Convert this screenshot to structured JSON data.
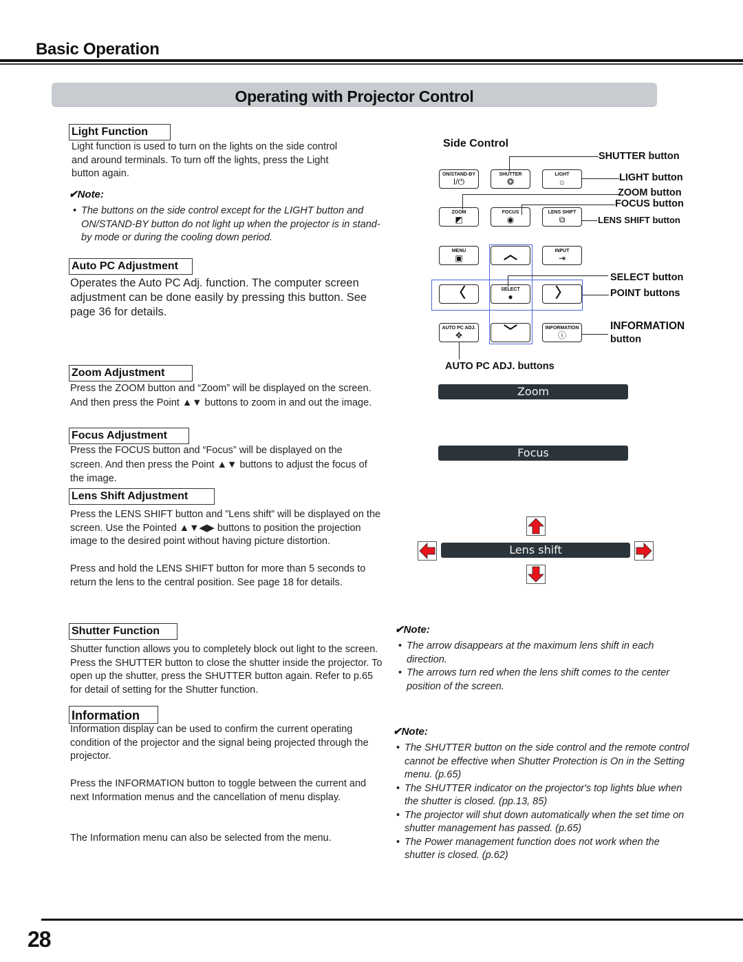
{
  "header": {
    "section_title": "Basic Operation",
    "banner_title": "Operating with Projector Control"
  },
  "light_function": {
    "heading": "Light Function",
    "body": "Light function is used to turn on the lights on the side control and around terminals. To turn off the lights, press the Light button again.",
    "note_title": "✔Note:",
    "notes": [
      "The buttons on the side control except for the LIGHT button and ON/STAND-BY button do not light up when the projector is in stand-by mode or during the cooling down period."
    ]
  },
  "auto_pc": {
    "heading": "Auto PC Adjustment",
    "body": "Operates the Auto PC Adj. function. The computer screen adjustment can be done easily by pressing this button. See page 36 for details."
  },
  "zoom_adj": {
    "heading": "Zoom Adjustment",
    "body": "Press the ZOOM button and “Zoom” will be displayed on the screen. And then press the Point ▲▼ buttons to zoom in and out the image."
  },
  "focus_adj": {
    "heading": "Focus Adjustment",
    "body": "Press the FOCUS button and “Focus” will be displayed on the screen. And then press the Point ▲▼ buttons to adjust the focus of the image."
  },
  "lens_shift_adj": {
    "heading": "Lens Shift Adjustment",
    "body1": "Press the LENS SHIFT button and ”Lens shift” will be displayed on the screen. Use the Pointed ▲▼◀▶ buttons to position the projection image to the desired point without having picture distortion.",
    "body2": "Press and hold the LENS SHIFT button for more than 5 seconds to return the lens to the central position. See page 18 for details."
  },
  "shutter": {
    "heading": "Shutter Function",
    "body": "Shutter function allows you to completely block out light to the screen. Press the SHUTTER button to close the shutter inside the projector. To open up the shutter, press the SHUTTER button again. Refer to p.65 for detail of setting for the Shutter function."
  },
  "information": {
    "heading": "Information",
    "body1": "Information display can be used to confirm the current operating condition of the projector and the signal being projected through the projector.",
    "body2": "Press the INFORMATION button to toggle between the current and next Information menus and the cancellation of menu display.",
    "body3": "The Information menu can also be selected from the menu."
  },
  "side_control": {
    "title": "Side Control",
    "buttons": {
      "on_standby": {
        "label": "ON/STAND-BY",
        "icon": "I/⏻"
      },
      "shutter": {
        "label": "SHUTTER",
        "icon": "❂"
      },
      "light": {
        "label": "LIGHT",
        "icon": "☼"
      },
      "zoom": {
        "label": "ZOOM",
        "icon": "◩"
      },
      "focus": {
        "label": "FOCUS",
        "icon": "◉"
      },
      "lens_shift": {
        "label": "LENS SHIFT",
        "icon": "⧉"
      },
      "menu": {
        "label": "MENU",
        "icon": "▣"
      },
      "up": {
        "label": "",
        "icon": "︿"
      },
      "input": {
        "label": "INPUT",
        "icon": "⇥"
      },
      "left": {
        "label": "",
        "icon": "〈"
      },
      "select": {
        "label": "SELECT",
        "icon": "●"
      },
      "right": {
        "label": "",
        "icon": "〉"
      },
      "auto_pc": {
        "label": "AUTO PC ADJ.",
        "icon": "✥"
      },
      "down": {
        "label": "",
        "icon": "﹀"
      },
      "information": {
        "label": "INFORMATION",
        "icon": "ⓘ"
      }
    },
    "callouts": {
      "shutter": "SHUTTER button",
      "light": "LIGHT button",
      "zoom": "ZOOM button",
      "focus": "FOCUS button",
      "lens_shift": "LENS SHIFT button",
      "select": "SELECT button",
      "point": "POINT buttons",
      "information_1": "INFORMATION",
      "information_2": "button",
      "auto_pc": "AUTO PC ADJ. buttons"
    }
  },
  "osd": {
    "zoom": "Zoom",
    "focus": "Focus",
    "lens_shift": "Lens shift",
    "arrow_color": "#e8141c"
  },
  "lens_note": {
    "title": "✔Note:",
    "notes": [
      "The arrow disappears at the maximum lens shift in each direction.",
      "The arrows turn red when the lens shift comes to the center position of the screen."
    ]
  },
  "shutter_note": {
    "title": "✔Note:",
    "notes": [
      "The SHUTTER button on the side control and the remote control cannot be effective when Shutter Protection is On in the Setting menu. (p.65)",
      "The SHUTTER indicator on the projector's top lights blue when the shutter is closed. (pp.13, 85)",
      "The projector will shut down automatically when the set time on shutter management has passed. (p.65)",
      "The Power management function does not work when the shutter is closed. (p.62)"
    ]
  },
  "footer": {
    "page_number": "28"
  }
}
